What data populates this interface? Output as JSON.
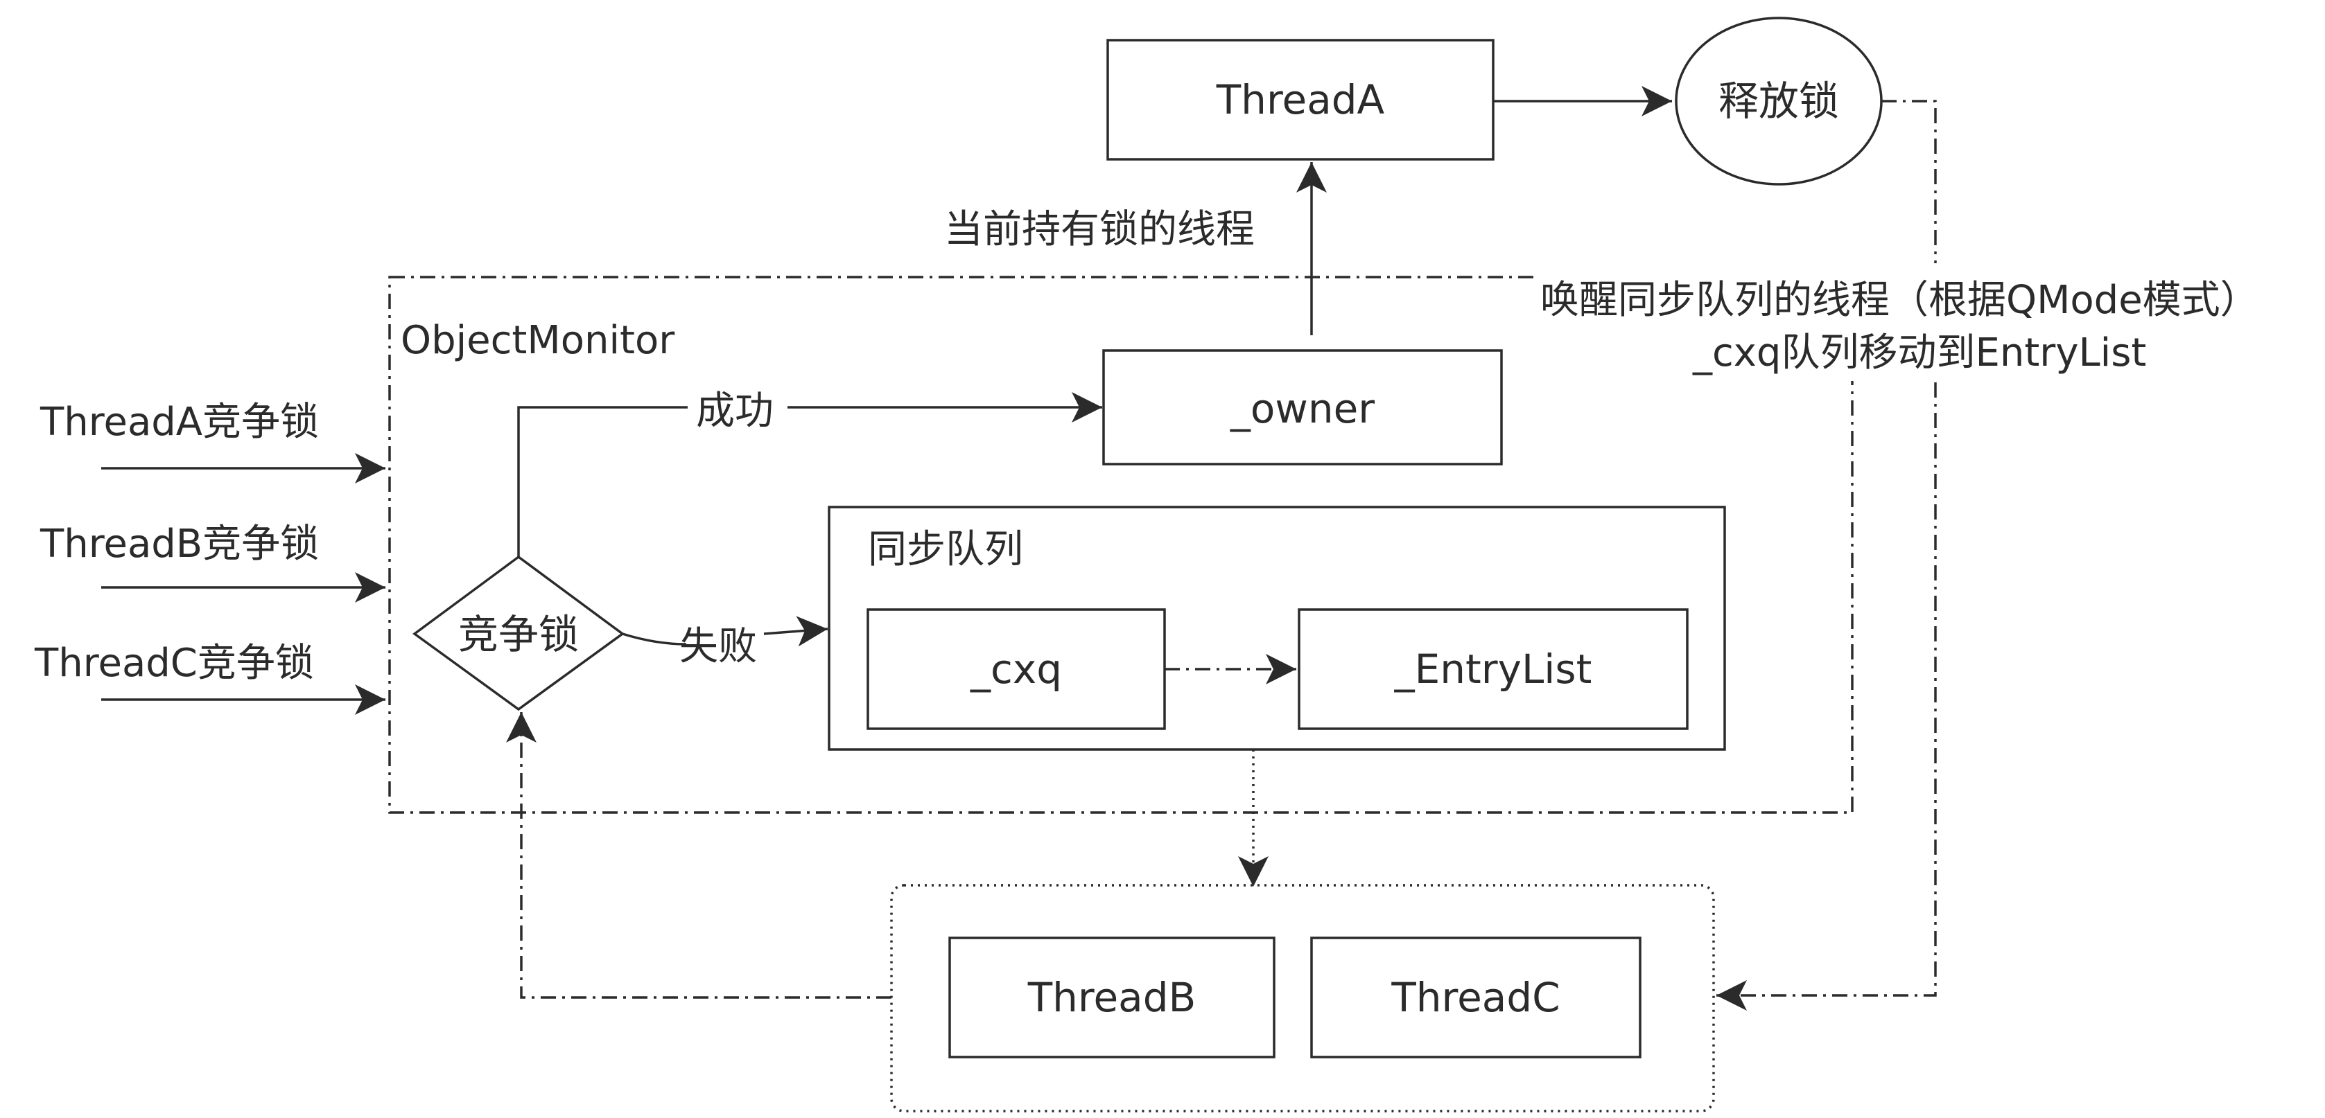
{
  "nodes": {
    "thread_a_top": "ThreadA",
    "release_lock": "释放锁",
    "owner": "_owner",
    "sync_queue_title": "同步队列",
    "cxq": "_cxq",
    "entry_list": "_EntryList",
    "compete_lock": "竞争锁",
    "thread_b": "ThreadB",
    "thread_c": "ThreadC"
  },
  "containers": {
    "object_monitor": "ObjectMonitor"
  },
  "labels": {
    "current_owner": "当前持有锁的线程",
    "wake_line1": "唤醒同步队列的线程（根据QMode模式）",
    "wake_line2": "_cxq队列移动到EntryList",
    "success": "成功",
    "fail": "失败",
    "thread_a_compete": "ThreadA竞争锁",
    "thread_b_compete": "ThreadB竞争锁",
    "thread_c_compete": "ThreadC竞争锁"
  },
  "colors": {
    "stroke": "#2b2b2b",
    "background": "#ffffff"
  }
}
